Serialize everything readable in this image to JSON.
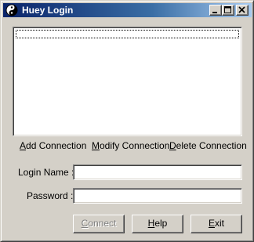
{
  "window": {
    "title": "Huey Login",
    "icon": "app-icon",
    "controls": [
      "minimize-icon",
      "maximize-icon",
      "close-icon"
    ]
  },
  "connections": {
    "items": [],
    "actions": {
      "add": {
        "hotkey": "A",
        "rest": "dd Connection"
      },
      "modify": {
        "hotkey": "M",
        "rest": "odify Connection"
      },
      "delete": {
        "hotkey": "D",
        "rest": "elete Connection"
      }
    }
  },
  "form": {
    "login_name": {
      "label": "Login Name :",
      "value": ""
    },
    "password": {
      "label": "Password :",
      "value": ""
    }
  },
  "buttons": {
    "connect": {
      "hotkey": "C",
      "rest": "onnect",
      "enabled": false
    },
    "help": {
      "hotkey": "H",
      "rest": "elp",
      "enabled": true
    },
    "exit": {
      "hotkey": "E",
      "rest": "xit",
      "enabled": true
    }
  },
  "colors": {
    "titlebar_start": "#0a246a",
    "titlebar_end": "#a6caf0",
    "face": "#d4d0c8"
  }
}
